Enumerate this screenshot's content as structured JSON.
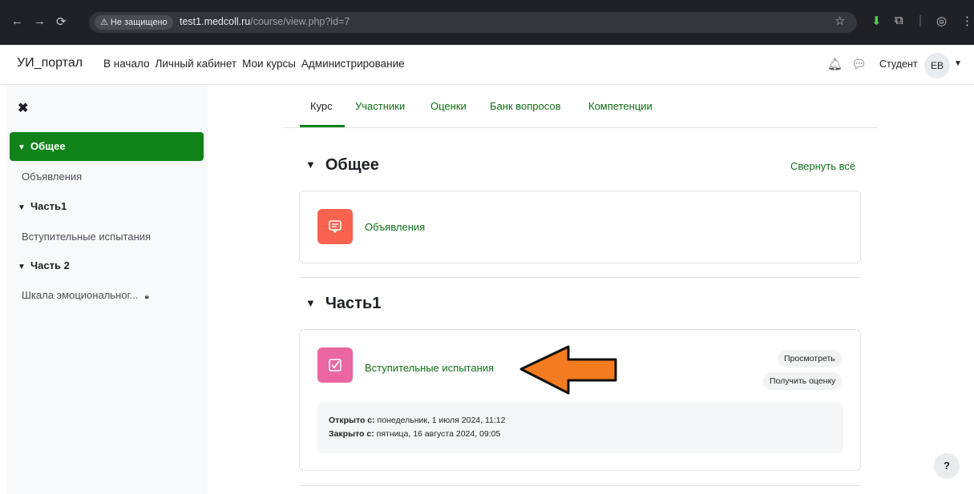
{
  "browser": {
    "insecure_label": "⚠ Не защищено",
    "url_host": "test1.medcoll.ru",
    "url_path": "/course/view.php?id=7"
  },
  "navbar": {
    "brand": "УИ_портал",
    "menu": [
      "В начало",
      "Личный кабинет",
      "Мои курсы",
      "Администрирование"
    ],
    "user_name": "Студент",
    "avatar_initials": "ЕВ"
  },
  "drawer": {
    "items": [
      {
        "label": "Общее",
        "type": "section",
        "active": true
      },
      {
        "label": "Объявления",
        "type": "activity"
      },
      {
        "label": "Часть1",
        "type": "section"
      },
      {
        "label": "Вступительные испытания",
        "type": "activity"
      },
      {
        "label": "Часть 2",
        "type": "section"
      },
      {
        "label": "Шкала эмоциональног...",
        "type": "activity",
        "locked": true
      }
    ]
  },
  "tabs": [
    "Курс",
    "Участники",
    "Оценки",
    "Банк вопросов",
    "Компетенции"
  ],
  "sections": [
    {
      "title": "Общее",
      "collapse_all": "Свернуть всё",
      "activities": [
        {
          "name": "Объявления",
          "icon": "forum-icon",
          "color": "#f7634d"
        }
      ]
    },
    {
      "title": "Часть1",
      "activities": [
        {
          "name": "Вступительные испытания",
          "icon": "quiz-icon",
          "color": "#eb66a2",
          "completion": [
            "Просмотреть",
            "Получить оценку"
          ],
          "opened_label": "Открыто с:",
          "opened_value": "понедельник, 1 июля 2024, 11:12",
          "closed_label": "Закрыто с:",
          "closed_value": "пятница, 16 августа 2024, 09:05"
        }
      ]
    }
  ],
  "help_label": "?",
  "colors": {
    "accent": "#0f8318",
    "link": "#0f6e16",
    "annotation_arrow": "#f47b20"
  }
}
